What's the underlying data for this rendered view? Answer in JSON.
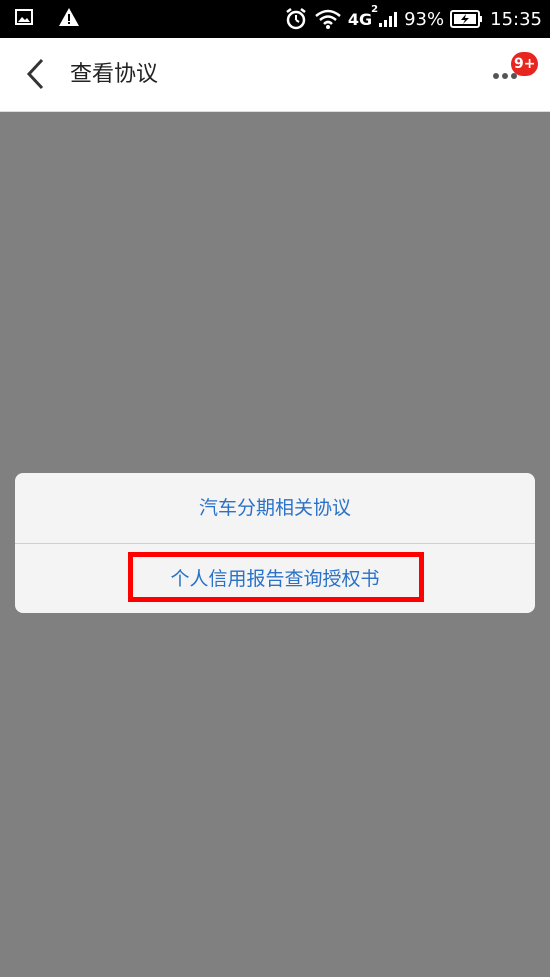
{
  "status_bar": {
    "network": "4G",
    "network_sup": "2",
    "battery": "93%",
    "time": "15:35"
  },
  "header": {
    "title": "查看协议",
    "badge": "9+"
  },
  "dialog": {
    "options": [
      {
        "label": "汽车分期相关协议"
      },
      {
        "label": "个人信用报告查询授权书"
      }
    ]
  },
  "colors": {
    "overlay": "#808080",
    "link": "#2a72c8",
    "badge": "#e8251f",
    "highlight": "#ff0000"
  }
}
